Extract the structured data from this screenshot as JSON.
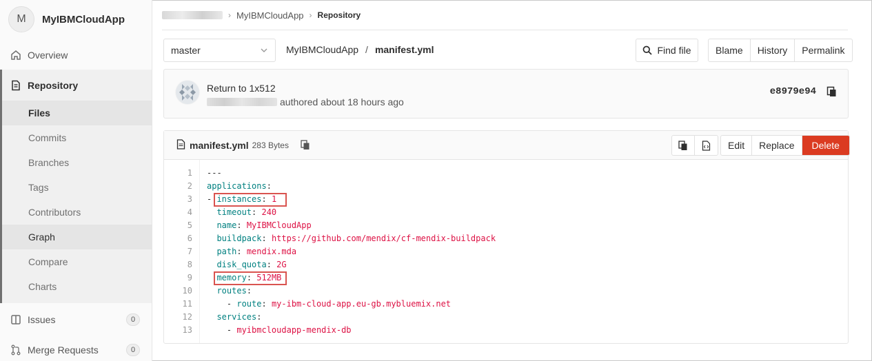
{
  "project": {
    "avatar_letter": "M",
    "name": "MyIBMCloudApp"
  },
  "sidebar": {
    "overview": "Overview",
    "repository": "Repository",
    "sub": [
      "Files",
      "Commits",
      "Branches",
      "Tags",
      "Contributors",
      "Graph",
      "Compare",
      "Charts"
    ],
    "issues": {
      "label": "Issues",
      "count": "0"
    },
    "merge_requests": {
      "label": "Merge Requests",
      "count": "0"
    }
  },
  "breadcrumb": {
    "project": "MyIBMCloudApp",
    "current": "Repository",
    "separator": "›"
  },
  "toolbar": {
    "branch": "master",
    "path_project": "MyIBMCloudApp",
    "path_sep": "/",
    "path_file": "manifest.yml",
    "find_file": "Find file",
    "blame": "Blame",
    "history": "History",
    "permalink": "Permalink"
  },
  "commit": {
    "title": "Return to 1x512",
    "authored": "authored about 18 hours ago",
    "sha": "e8979e94"
  },
  "file": {
    "name": "manifest.yml",
    "size": "283 Bytes",
    "edit": "Edit",
    "replace": "Replace",
    "delete": "Delete",
    "line_numbers": [
      "1",
      "2",
      "3",
      "4",
      "5",
      "6",
      "7",
      "8",
      "9",
      "10",
      "11",
      "12",
      "13"
    ],
    "lines": [
      {
        "indent": "",
        "prefix": "",
        "key": "---",
        "sep": "",
        "value": ""
      },
      {
        "indent": "",
        "prefix": "",
        "key": "applications",
        "sep": ":",
        "value": ""
      },
      {
        "indent": "",
        "prefix": "- ",
        "key": "instances",
        "sep": ": ",
        "value": "1"
      },
      {
        "indent": "  ",
        "prefix": "",
        "key": "timeout",
        "sep": ": ",
        "value": "240"
      },
      {
        "indent": "  ",
        "prefix": "",
        "key": "name",
        "sep": ": ",
        "value": "MyIBMCloudApp"
      },
      {
        "indent": "  ",
        "prefix": "",
        "key": "buildpack",
        "sep": ": ",
        "value": "https://github.com/mendix/cf-mendix-buildpack"
      },
      {
        "indent": "  ",
        "prefix": "",
        "key": "path",
        "sep": ": ",
        "value": "mendix.mda"
      },
      {
        "indent": "  ",
        "prefix": "",
        "key": "disk_quota",
        "sep": ": ",
        "value": "2G"
      },
      {
        "indent": "  ",
        "prefix": "",
        "key": "memory",
        "sep": ": ",
        "value": "512MB"
      },
      {
        "indent": "  ",
        "prefix": "",
        "key": "routes",
        "sep": ":",
        "value": ""
      },
      {
        "indent": "    ",
        "prefix": "- ",
        "key": "route",
        "sep": ": ",
        "value": "my-ibm-cloud-app.eu-gb.mybluemix.net"
      },
      {
        "indent": "  ",
        "prefix": "",
        "key": "services",
        "sep": ":",
        "value": ""
      },
      {
        "indent": "    ",
        "prefix": "- ",
        "key": "",
        "sep": "",
        "value": "myibmcloudapp-mendix-db"
      }
    ]
  },
  "colors": {
    "key": "#008080",
    "value": "#dd1144",
    "delete_button": "#db3b21",
    "highlight_box": "#d9534f"
  }
}
